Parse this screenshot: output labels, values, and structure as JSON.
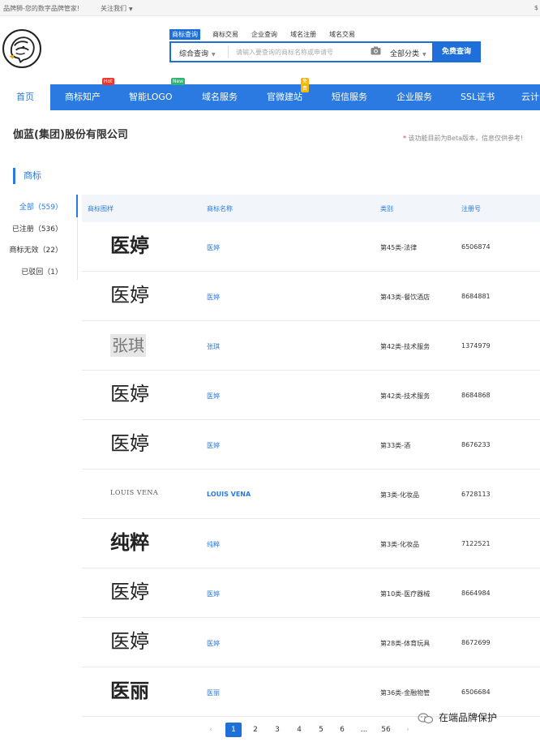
{
  "topbar": {
    "slogan": "品牌狮-您的数字品牌管家!",
    "follow": "关注我们",
    "edge": "$"
  },
  "search": {
    "tabs": [
      "商标查询",
      "商标交易",
      "企业查询",
      "域名注册",
      "域名交易"
    ],
    "scope": "综合查询",
    "placeholder": "请输入要查询的商标名称或申请号",
    "category": "全部分类",
    "button": "免费查询"
  },
  "nav": {
    "items": [
      {
        "label": "首页"
      },
      {
        "label": "商标知产",
        "badge": "Hot"
      },
      {
        "label": "智能LOGO",
        "badge": "New"
      },
      {
        "label": "域名服务"
      },
      {
        "label": "官微建站",
        "badge": "免费"
      },
      {
        "label": "短信服务"
      },
      {
        "label": "企业服务"
      },
      {
        "label": "SSL证书"
      },
      {
        "label": "云计"
      }
    ]
  },
  "company": {
    "name": "伽蓝(集团)股份有限公司",
    "beta_star": "*",
    "beta_note": "该功能目前为Beta版本，信息仅供参考!"
  },
  "section": {
    "title": "商标"
  },
  "filters": [
    {
      "label": "全部（559）"
    },
    {
      "label": "已注册（536）"
    },
    {
      "label": "商标无效（22）"
    },
    {
      "label": "已驳回（1）"
    }
  ],
  "table": {
    "headers": [
      "商标图样",
      "商标名称",
      "类别",
      "注册号"
    ],
    "rows": [
      {
        "image_text": "医婷",
        "name": "医婷",
        "class": "第45类-法律",
        "reg": "6506874"
      },
      {
        "image_text": "医婷",
        "name": "医婷",
        "class": "第43类-餐饮酒店",
        "reg": "8684881"
      },
      {
        "image_text": "张琪",
        "name": "张琪",
        "class": "第42类-技术服务",
        "reg": "1374979"
      },
      {
        "image_text": "医婷",
        "name": "医婷",
        "class": "第42类-技术服务",
        "reg": "8684868"
      },
      {
        "image_text": "医婷",
        "name": "医婷",
        "class": "第33类-酒",
        "reg": "8676233"
      },
      {
        "image_text": "LOUIS VENA",
        "name": "LOUIS VENA",
        "class": "第3类-化妆品",
        "reg": "6728113"
      },
      {
        "image_text": "纯粹",
        "name": "纯粹",
        "class": "第3类-化妆品",
        "reg": "7122521"
      },
      {
        "image_text": "医婷",
        "name": "医婷",
        "class": "第10类-医疗器械",
        "reg": "8664984"
      },
      {
        "image_text": "医婷",
        "name": "医婷",
        "class": "第28类-体育玩具",
        "reg": "8672699"
      },
      {
        "image_text": "医丽",
        "name": "医丽",
        "class": "第36类-金融物管",
        "reg": "6506684"
      }
    ]
  },
  "pagination": {
    "prev": "‹",
    "pages": [
      "1",
      "2",
      "3",
      "4",
      "5",
      "6",
      "...",
      "56"
    ],
    "next": "›",
    "current": "1"
  },
  "watermark": "在端品牌保护",
  "colors": {
    "accent": "#2a7ae2",
    "hot": "#e8382e",
    "new": "#2bb673",
    "free": "#f5b60a"
  }
}
